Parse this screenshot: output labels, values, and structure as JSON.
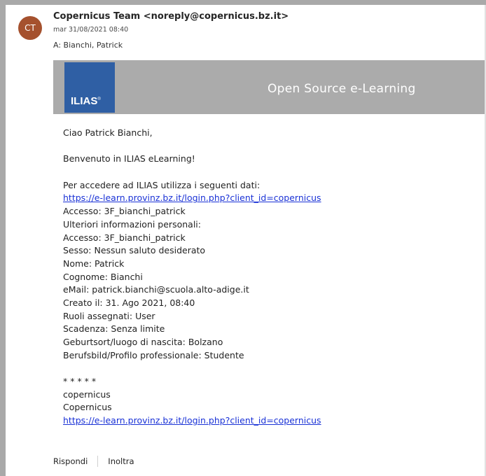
{
  "header": {
    "avatar_initials": "CT",
    "sender": "Copernicus Team <noreply@copernicus.bz.it>",
    "date": "mar 31/08/2021 08:40",
    "to": "A: Bianchi, Patrick"
  },
  "banner": {
    "logo_text": "ILIAS",
    "logo_mark": "®",
    "tagline": "Open Source e-Learning"
  },
  "body": {
    "greeting": "Ciao Patrick Bianchi,",
    "welcome": "Benvenuto in ILIAS eLearning!",
    "intro": "Per accedere ad ILIAS utilizza i seguenti dati:",
    "link": "https://e-learn.provinz.bz.it/login.php?client_id=copernicus",
    "details": [
      "Accesso: 3F_bianchi_patrick",
      "Ulteriori informazioni personali:",
      "Accesso: 3F_bianchi_patrick",
      "Sesso: Nessun saluto desiderato",
      "Nome: Patrick",
      "Cognome: Bianchi",
      "eMail: patrick.bianchi@scuola.alto-adige.it",
      "Creato il: 31. Ago 2021, 08:40",
      "Ruoli assegnati: User",
      "Scadenza: Senza limite",
      "Geburtsort/luogo di nascita: Bolzano",
      "Berufsbild/Profilo professionale: Studente"
    ],
    "signature_stars": "* * * * *",
    "signature_line1": "copernicus",
    "signature_line2": "Copernicus",
    "signature_link": "https://e-learn.provinz.bz.it/login.php?client_id=copernicus"
  },
  "actions": {
    "reply": "Rispondi",
    "forward": "Inoltra"
  },
  "colors": {
    "avatar": "#a5512e",
    "logo": "#2f5fa4",
    "banner": "#ababab",
    "link": "#1a32d6"
  }
}
